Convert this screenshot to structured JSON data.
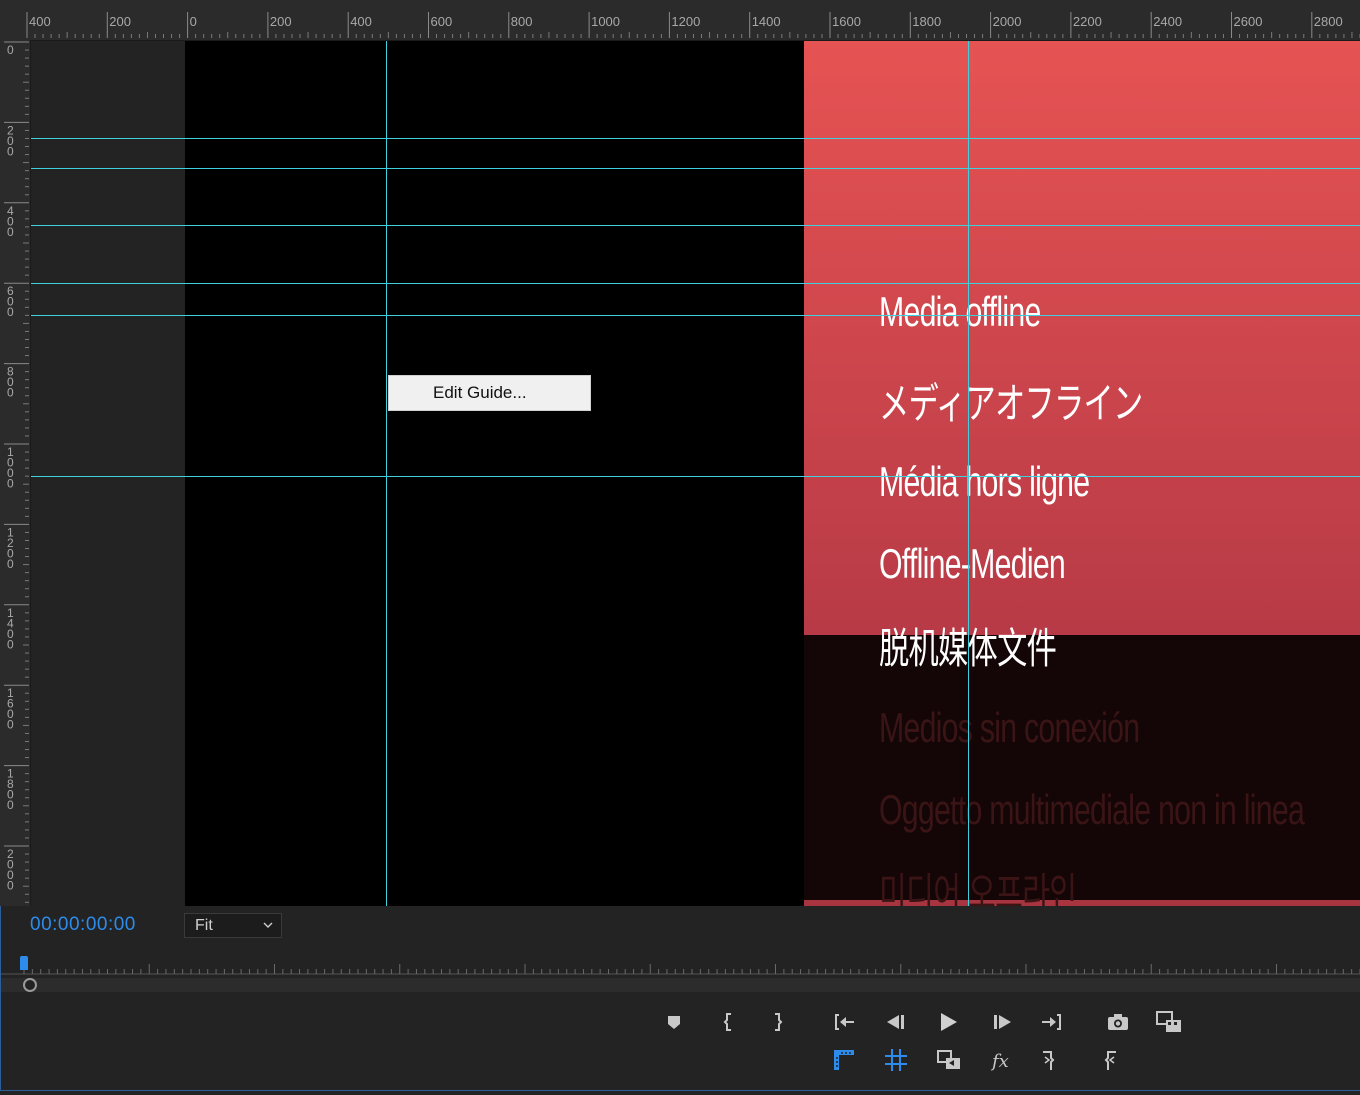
{
  "top_ruler": {
    "labels": [
      "400",
      "200",
      "0",
      "200",
      "400",
      "600",
      "800",
      "1000",
      "1200",
      "1400",
      "1600",
      "1800",
      "2000",
      "2200",
      "2400",
      "2600",
      "2800"
    ]
  },
  "left_ruler": {
    "labels": [
      "0",
      "200",
      "400",
      "600",
      "800",
      "1000",
      "1200",
      "1400",
      "1600",
      "1800",
      "2000"
    ]
  },
  "offline_media": {
    "lines": [
      "Media offline",
      "メディアオフライン",
      "Média hors ligne",
      "Offline-Medien",
      "脱机媒体文件",
      "Medios sin conexión",
      "Oggetto multimediale non in linea",
      "미디어 오프라인"
    ]
  },
  "context_menu": {
    "edit_guide": "Edit Guide..."
  },
  "controls": {
    "timecode": "00:00:00:00",
    "zoom": "Fit"
  },
  "colors": {
    "guide": "#3fd0df",
    "accent": "#2d8ceb",
    "offline_top": "#e65353",
    "offline_bottom": "#b73a46"
  },
  "buttons": {
    "row1": [
      "add-marker-icon",
      "mark-in-icon",
      "mark-out-icon",
      "go-to-in-icon",
      "step-back-icon",
      "play-icon",
      "step-forward-icon",
      "go-to-out-icon",
      "export-frame-icon",
      "comparison-view-icon"
    ],
    "row2": [
      "show-rulers-icon",
      "show-guides-icon",
      "toggle-proxies-icon",
      "fx-icon",
      "insert-icon",
      "overwrite-icon"
    ]
  }
}
